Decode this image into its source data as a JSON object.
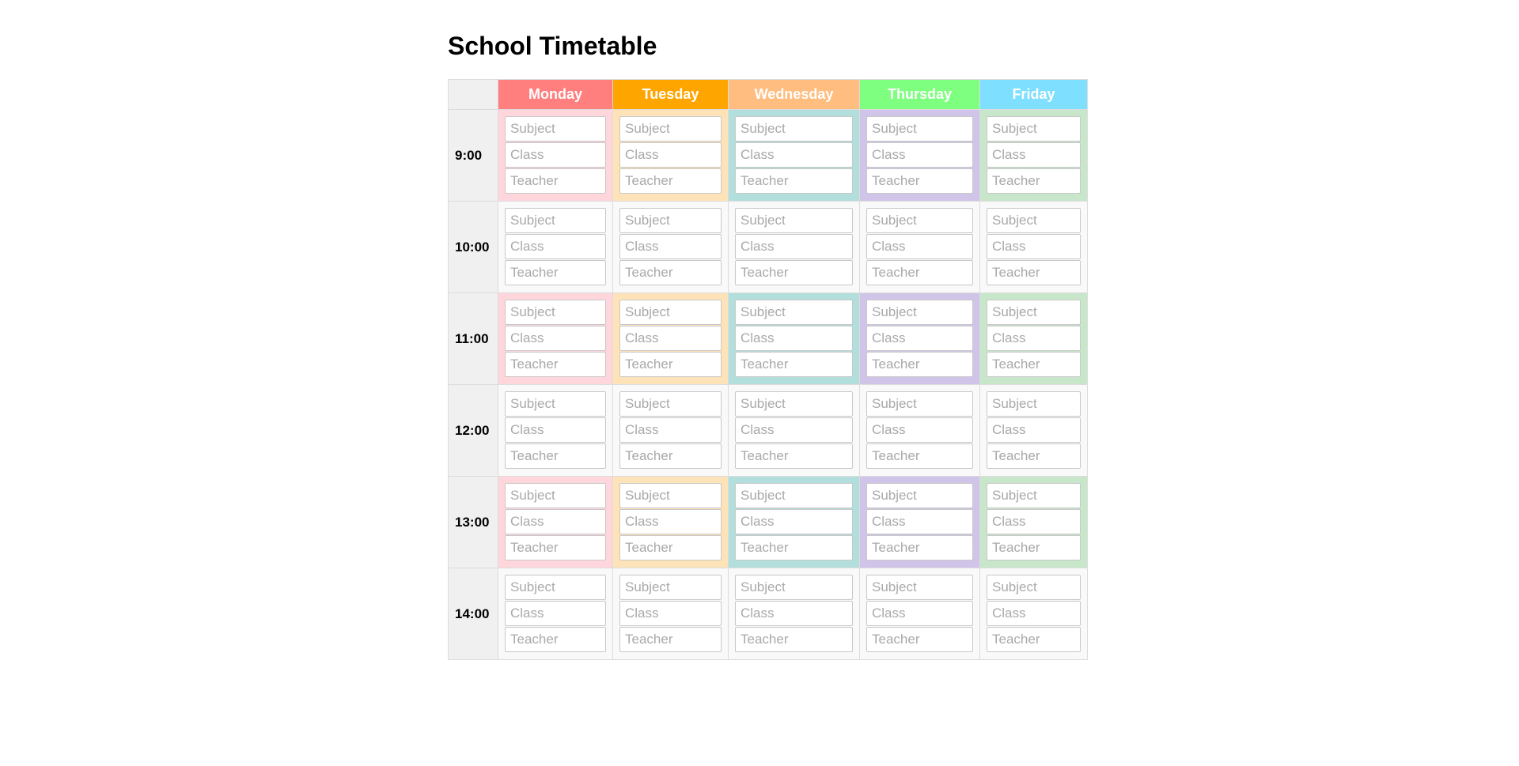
{
  "page": {
    "title": "School Timetable"
  },
  "days": [
    {
      "label": "Monday",
      "color": "#ff7f7f",
      "tint": "#ffd6dc"
    },
    {
      "label": "Tuesday",
      "color": "#ffa500",
      "tint": "#ffe3b8"
    },
    {
      "label": "Wednesday",
      "color": "#ffbd7f",
      "tint": "#b2dfdb"
    },
    {
      "label": "Thursday",
      "color": "#7fff7f",
      "tint": "#d1c4e9"
    },
    {
      "label": "Friday",
      "color": "#7fdfff",
      "tint": "#c8e6c9"
    }
  ],
  "times": [
    {
      "label": "9:00",
      "shaded": true
    },
    {
      "label": "10:00",
      "shaded": false
    },
    {
      "label": "11:00",
      "shaded": true
    },
    {
      "label": "12:00",
      "shaded": false
    },
    {
      "label": "13:00",
      "shaded": true
    },
    {
      "label": "14:00",
      "shaded": false
    }
  ],
  "fields": [
    {
      "key": "subject",
      "placeholder": "Subject",
      "value": ""
    },
    {
      "key": "class",
      "placeholder": "Class",
      "value": ""
    },
    {
      "key": "teacher",
      "placeholder": "Teacher",
      "value": ""
    }
  ]
}
